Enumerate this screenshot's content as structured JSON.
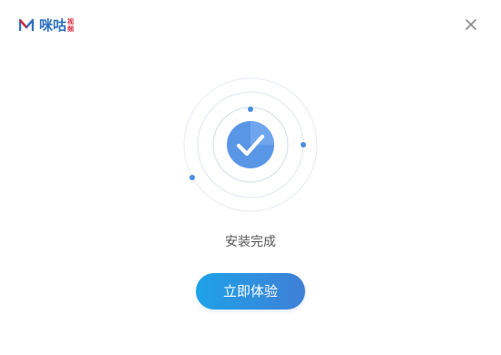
{
  "app": {
    "logo_text": "咪咕",
    "logo_sub": "视频",
    "brand_color": "#2a6fc0",
    "brand_accent": "#d9263a"
  },
  "window": {
    "close_icon": "close-icon"
  },
  "status": {
    "text": "安装完成",
    "icon": "check-icon"
  },
  "actions": {
    "primary_label": "立即体验",
    "gradient_start": "#1ea2e8",
    "gradient_end": "#3f7fd6"
  }
}
